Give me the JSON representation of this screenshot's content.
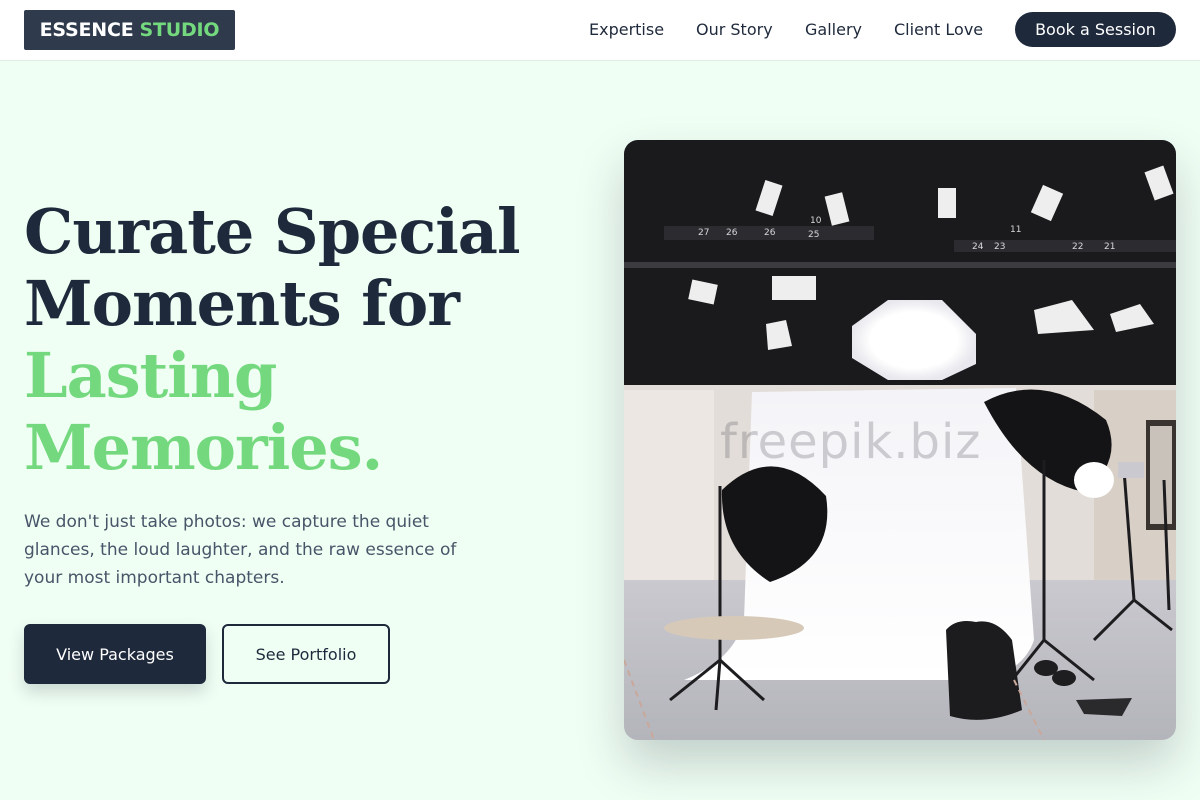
{
  "brand": {
    "name_primary": "ESSENCE",
    "name_accent": "STUDIO",
    "accent_color": "#74d97e",
    "dark_color": "#1e293b"
  },
  "nav": {
    "items": [
      {
        "label": "Expertise"
      },
      {
        "label": "Our Story"
      },
      {
        "label": "Gallery"
      },
      {
        "label": "Client Love"
      }
    ],
    "cta_label": "Book a Session"
  },
  "hero": {
    "headline_line1": "Curate Special",
    "headline_line2": "Moments for",
    "headline_accent_line1": "Lasting",
    "headline_accent_line2": "Memories.",
    "description": "We don't just take photos: we capture the quiet glances, the loud laughter, and the raw essence of your most important chapters.",
    "primary_button": "View Packages",
    "secondary_button": "See Portfolio"
  },
  "image": {
    "subject": "photo studio with white backdrop, softbox umbrellas and ceiling light rig",
    "watermark": "freepik.biz",
    "rig_labels": [
      "27",
      "26",
      "26",
      "25",
      "10",
      "11",
      "24",
      "23",
      "22",
      "21"
    ]
  }
}
